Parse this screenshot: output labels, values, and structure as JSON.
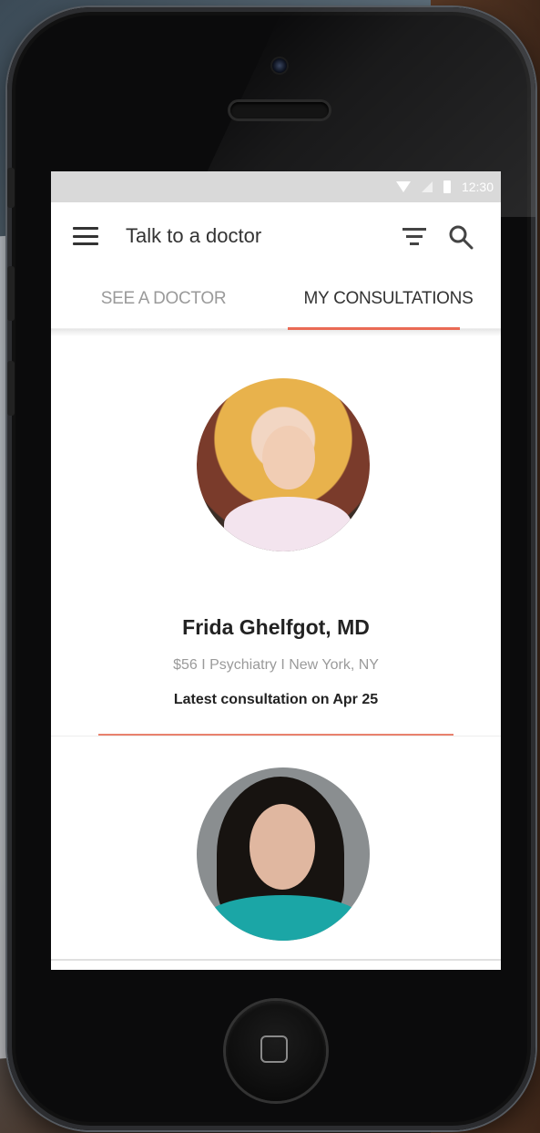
{
  "status_bar": {
    "time": "12:30"
  },
  "app_bar": {
    "title": "Talk to a doctor"
  },
  "tabs": [
    {
      "label": "SEE A DOCTOR",
      "active": false
    },
    {
      "label": "MY CONSULTATIONS",
      "active": true
    }
  ],
  "doctors": [
    {
      "name": "Frida Ghelfgot, MD",
      "meta": "$56 I Psychiatry I New York, NY",
      "latest": "Latest consultation on Apr 25"
    }
  ],
  "colors": {
    "accent": "#ea6a55",
    "divider": "#e9816d",
    "status_bar": "#d9d9d9"
  }
}
